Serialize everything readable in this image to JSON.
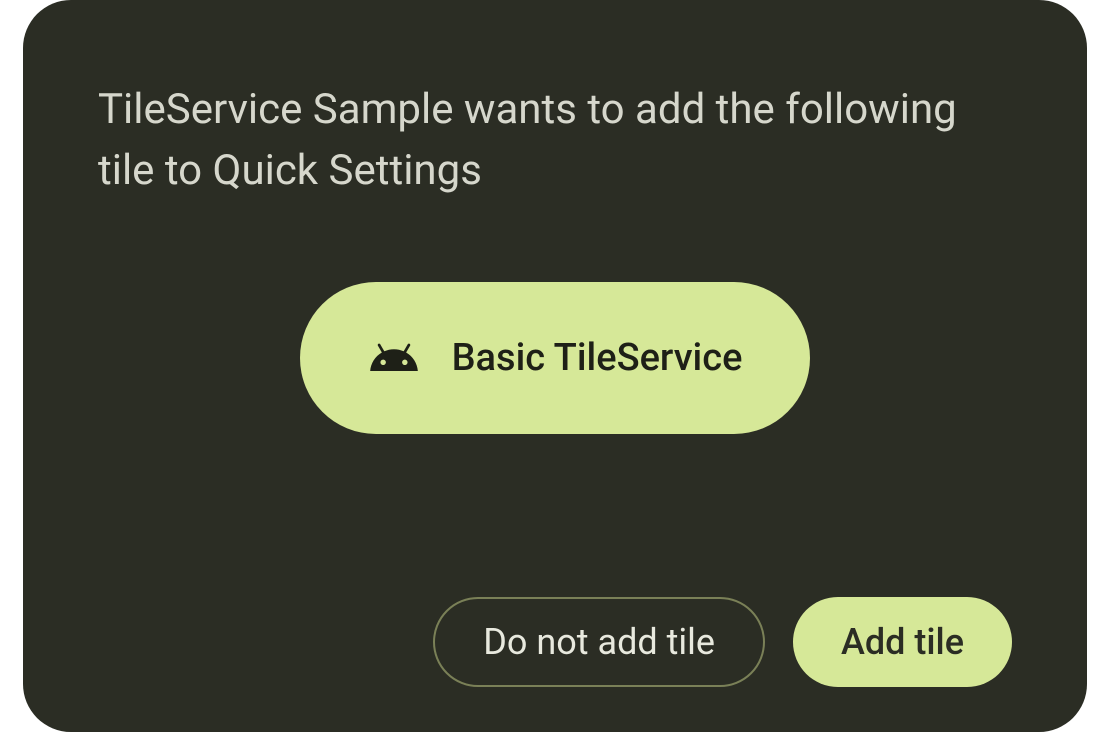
{
  "dialog": {
    "title": "TileService Sample wants to add the following tile to Quick Settings",
    "tile": {
      "icon_name": "android-icon",
      "label": "Basic TileService"
    },
    "buttons": {
      "cancel": "Do not add tile",
      "confirm": "Add tile"
    }
  },
  "colors": {
    "background": "#2b2d24",
    "accent": "#d6e898",
    "text_light": "#d6d7cc",
    "text_dark": "#1e2017",
    "outline": "#7a8057"
  }
}
